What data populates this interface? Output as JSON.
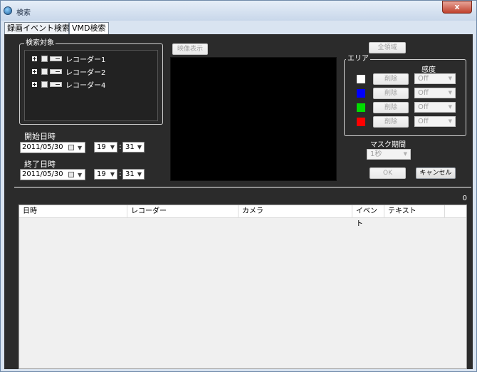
{
  "window": {
    "title": "検索",
    "close_label": "x"
  },
  "tabs": [
    {
      "label": "録画イベント検索"
    },
    {
      "label": "VMD検索"
    }
  ],
  "search_target": {
    "legend": "検索対象",
    "recorders": [
      {
        "label": "レコーダー1"
      },
      {
        "label": "レコーダー2"
      },
      {
        "label": "レコーダー4"
      }
    ]
  },
  "start": {
    "label": "開始日時",
    "date": "2011/05/30",
    "hour": "19",
    "minute": "31"
  },
  "end": {
    "label": "終了日時",
    "date": "2011/05/30",
    "hour": "19",
    "minute": "31"
  },
  "video_button": "映像表示",
  "all_area_button": "全領域",
  "area": {
    "legend": "エリア",
    "sensitivity_label": "感度",
    "rows": [
      {
        "color": "#ffffff",
        "delete_label": "削除",
        "sensitivity": "Off"
      },
      {
        "color": "#0000ff",
        "delete_label": "削除",
        "sensitivity": "Off"
      },
      {
        "color": "#00dd00",
        "delete_label": "削除",
        "sensitivity": "Off"
      },
      {
        "color": "#ff0000",
        "delete_label": "削除",
        "sensitivity": "Off"
      }
    ]
  },
  "mask": {
    "label": "マスク期間",
    "value": "1秒"
  },
  "ok_label": "OK",
  "cancel_label": "キャンセル",
  "result_count": "0",
  "table": {
    "columns": [
      "日時",
      "レコーダー",
      "カメラ",
      "イベント",
      "テキスト"
    ]
  }
}
